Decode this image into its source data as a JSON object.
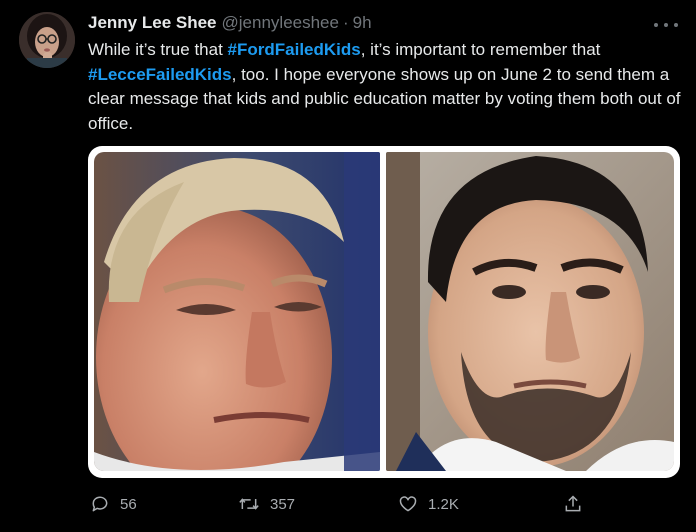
{
  "tweet": {
    "author": {
      "display_name": "Jenny Lee Shee",
      "handle": "@jennyleeshee",
      "separator": "·",
      "time": "9h"
    },
    "text": {
      "part1": "While it’s true that ",
      "hashtag1": "#FordFailedKids",
      "part2": ", it’s important to remember that ",
      "hashtag2": "#LecceFailedKids",
      "part3": ", too. I hope everyone shows up on June 2 to send them a clear message that kids and public education matter by voting them both out of office."
    },
    "media": {
      "images": [
        {
          "name": "photo-older-man"
        },
        {
          "name": "photo-younger-man"
        }
      ]
    },
    "actions": {
      "reply_icon": "reply-icon",
      "reply_count": "56",
      "retweet_icon": "retweet-icon",
      "retweet_count": "357",
      "like_icon": "heart-icon",
      "like_count": "1.2K",
      "share_icon": "share-icon"
    }
  },
  "colors": {
    "background": "#000000",
    "text": "#e7e9ea",
    "muted": "#71767b",
    "hashtag": "#1d9bf0"
  }
}
